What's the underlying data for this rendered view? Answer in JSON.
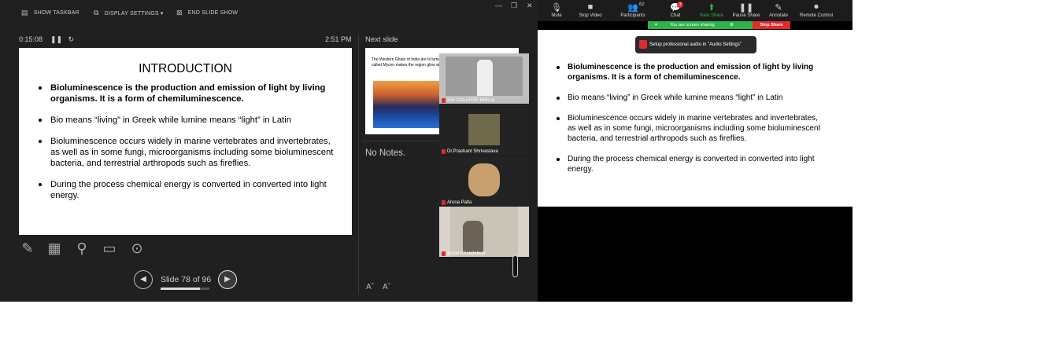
{
  "presenter": {
    "toolbar": {
      "show_taskbar": "SHOW TASKBAR",
      "display_settings": "DISPLAY SETTINGS ▾",
      "end_show": "END SLIDE SHOW"
    },
    "timer": "0:15:08",
    "clock": "2:51 PM",
    "slide": {
      "title": "INTRODUCTION",
      "bullets": [
        "Bioluminescence is the production and emission of light by living organisms. It is a form of chemiluminescence.",
        "Bio means “living” in Greek while lumine means “light” in Latin",
        " Bioluminescence occurs widely in marine vertebrates and invertebrates, as well as in some fungi, microorganisms including some bioluminescent bacteria, and terrestrial arthropods such as fireflies.",
        "During the process chemical energy is converted in converted into light energy."
      ]
    },
    "slide_counter": "Slide 78 of 96",
    "slide_progress": 0.81,
    "next_slide_label": "Next slide",
    "next_slide_text": "The Western Ghats of India are bl luminescent fungus called Mycen makes the region glow at night!",
    "notes": "No Notes.",
    "font_up": "Aˆ",
    "font_down": "Aˇ"
  },
  "participants": [
    {
      "name": "SAI COLLEGE BHILAI",
      "muted": true
    },
    {
      "name": "Dr.Prashant Shrivastava",
      "muted": true
    },
    {
      "name": "Aruna Palta",
      "muted": true
    },
    {
      "name": "Sonal Khandelwal",
      "muted": true
    }
  ],
  "zoom": {
    "toolbar": [
      {
        "label": "Mute",
        "icon": "mic-icon"
      },
      {
        "label": "Stop Video",
        "icon": "video-icon"
      },
      {
        "label": "Participants",
        "icon": "participants-icon",
        "count": "62"
      },
      {
        "label": "Chat",
        "icon": "chat-icon",
        "badge": "3"
      },
      {
        "label": "New Share",
        "icon": "share-icon"
      },
      {
        "label": "Pause Share",
        "icon": "pause-icon"
      },
      {
        "label": "Annotate",
        "icon": "pen-icon"
      },
      {
        "label": "Remote Control",
        "icon": "mouse-icon"
      }
    ],
    "sharing_text": "You are screen sharing",
    "stop_share": "Stop Share",
    "toast": "Setup professional audio in \"Audio Settings\"",
    "slide_title": "INTRODUCTION",
    "bullets": [
      "Bioluminescence is the production and emission of light by living organisms. It is a form of chemiluminescence.",
      "Bio means “living” in Greek while lumine means “light” in Latin",
      " Bioluminescence occurs widely in marine vertebrates and invertebrates, as well as in some fungi, microorganisms including some bioluminescent bacteria, and terrestrial arthropods such as fireflies.",
      "During the process chemical energy is converted in converted into light energy."
    ]
  },
  "colors": {
    "share_green": "#2db34a",
    "stop_red": "#e02b2b",
    "presenter_bg": "#202020"
  }
}
